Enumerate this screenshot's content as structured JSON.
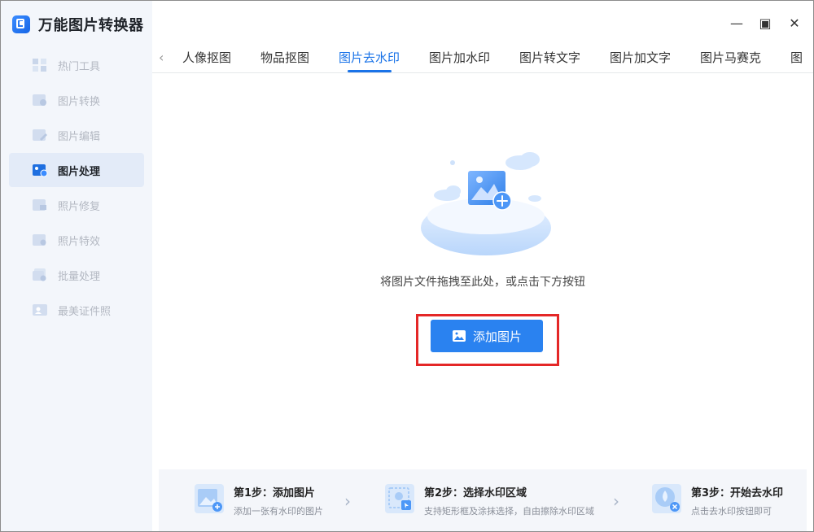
{
  "app": {
    "title": "万能图片转换器"
  },
  "window_controls": {
    "minimize": "—",
    "maximize": "▣",
    "close": "✕"
  },
  "sidebar": {
    "items": [
      {
        "label": "热门工具",
        "icon": "grid-icon"
      },
      {
        "label": "图片转换",
        "icon": "image-convert-icon"
      },
      {
        "label": "图片编辑",
        "icon": "image-edit-icon"
      },
      {
        "label": "图片处理",
        "icon": "image-process-icon",
        "active": true
      },
      {
        "label": "照片修复",
        "icon": "photo-repair-icon"
      },
      {
        "label": "照片特效",
        "icon": "photo-effect-icon"
      },
      {
        "label": "批量处理",
        "icon": "batch-icon"
      },
      {
        "label": "最美证件照",
        "icon": "id-photo-icon"
      }
    ]
  },
  "tabs": {
    "items": [
      "人像抠图",
      "物品抠图",
      "图片去水印",
      "图片加水印",
      "图片转文字",
      "图片加文字",
      "图片马赛克",
      "图"
    ],
    "active_index": 2
  },
  "main": {
    "hint": "将图片文件拖拽至此处，或点击下方按钮",
    "add_button": "添加图片"
  },
  "steps": [
    {
      "title": "第1步：添加图片",
      "desc": "添加一张有水印的图片"
    },
    {
      "title": "第2步：选择水印区域",
      "desc": "支持矩形框及涂抹选择，自由擦除水印区域"
    },
    {
      "title": "第3步：开始去水印",
      "desc": "点击去水印按钮即可"
    }
  ],
  "colors": {
    "accent": "#2a82f0",
    "highlight": "#e42727",
    "sidebar_bg": "#f3f6fb"
  }
}
